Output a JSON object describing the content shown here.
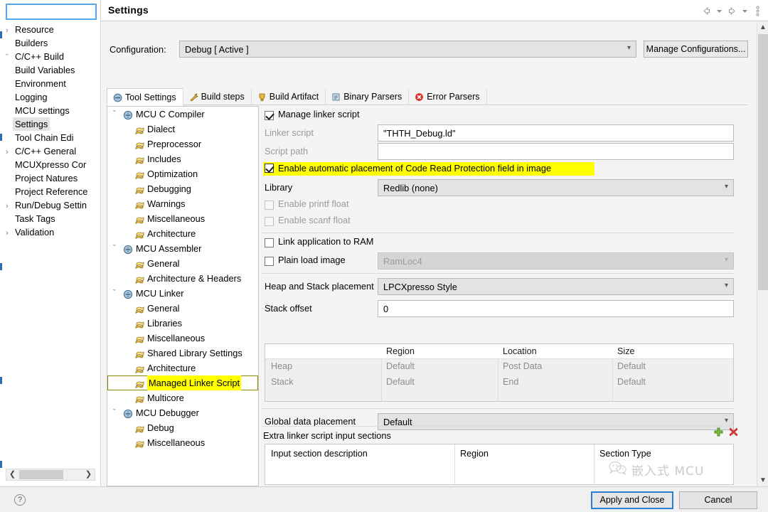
{
  "window": {
    "title": "Settings",
    "toolbar_icons": [
      "back-arrow-icon",
      "back-dropdown-icon",
      "forward-arrow-icon",
      "forward-dropdown-icon",
      "view-menu-icon"
    ]
  },
  "sidebar": {
    "filter_value": "",
    "filter_placeholder": "",
    "items": [
      {
        "label": "Resource",
        "arrow": "›",
        "indent": 0,
        "selected": false
      },
      {
        "label": "Builders",
        "arrow": "",
        "indent": 1,
        "selected": false
      },
      {
        "label": "C/C++ Build",
        "arrow": "⌄",
        "indent": 0,
        "selected": false
      },
      {
        "label": "Build Variables",
        "arrow": "",
        "indent": 1,
        "selected": false
      },
      {
        "label": "Environment",
        "arrow": "",
        "indent": 1,
        "selected": false
      },
      {
        "label": "Logging",
        "arrow": "",
        "indent": 1,
        "selected": false
      },
      {
        "label": "MCU settings",
        "arrow": "",
        "indent": 1,
        "selected": false
      },
      {
        "label": "Settings",
        "arrow": "",
        "indent": 1,
        "selected": true
      },
      {
        "label": "Tool Chain Edi",
        "arrow": "",
        "indent": 1,
        "selected": false
      },
      {
        "label": "C/C++ General",
        "arrow": "›",
        "indent": 0,
        "selected": false
      },
      {
        "label": "MCUXpresso Cor",
        "arrow": "",
        "indent": 1,
        "selected": false
      },
      {
        "label": "Project Natures",
        "arrow": "",
        "indent": 1,
        "selected": false
      },
      {
        "label": "Project Reference",
        "arrow": "",
        "indent": 1,
        "selected": false
      },
      {
        "label": "Run/Debug Settin",
        "arrow": "›",
        "indent": 0,
        "selected": false
      },
      {
        "label": "Task Tags",
        "arrow": "",
        "indent": 1,
        "selected": false
      },
      {
        "label": "Validation",
        "arrow": "›",
        "indent": 0,
        "selected": false
      }
    ],
    "hscroll": {
      "left_icon": "chevron-left-icon",
      "right_icon": "chevron-right-icon"
    }
  },
  "config": {
    "label": "Configuration:",
    "value": "Debug  [ Active ]",
    "manage_label": "Manage Configurations..."
  },
  "tabs": [
    {
      "label": "Tool Settings",
      "icon": "tool-settings-icon",
      "active": true
    },
    {
      "label": "Build steps",
      "icon": "wrench-icon",
      "active": false
    },
    {
      "label": "Build Artifact",
      "icon": "artifact-icon",
      "active": false
    },
    {
      "label": "Binary Parsers",
      "icon": "binary-parsers-icon",
      "active": false
    },
    {
      "label": "Error Parsers",
      "icon": "error-parsers-icon",
      "active": false
    }
  ],
  "tool_tree": [
    {
      "label": "MCU C Compiler",
      "level": 0,
      "arrow": "⌄",
      "icon": "tool-icon",
      "highlighted": false
    },
    {
      "label": "Dialect",
      "level": 1,
      "arrow": "",
      "icon": "page-icon",
      "highlighted": false
    },
    {
      "label": "Preprocessor",
      "level": 1,
      "arrow": "",
      "icon": "page-icon",
      "highlighted": false
    },
    {
      "label": "Includes",
      "level": 1,
      "arrow": "",
      "icon": "page-icon",
      "highlighted": false
    },
    {
      "label": "Optimization",
      "level": 1,
      "arrow": "",
      "icon": "page-icon",
      "highlighted": false
    },
    {
      "label": "Debugging",
      "level": 1,
      "arrow": "",
      "icon": "page-icon",
      "highlighted": false
    },
    {
      "label": "Warnings",
      "level": 1,
      "arrow": "",
      "icon": "page-icon",
      "highlighted": false
    },
    {
      "label": "Miscellaneous",
      "level": 1,
      "arrow": "",
      "icon": "page-icon",
      "highlighted": false
    },
    {
      "label": "Architecture",
      "level": 1,
      "arrow": "",
      "icon": "page-icon",
      "highlighted": false
    },
    {
      "label": "MCU Assembler",
      "level": 0,
      "arrow": "⌄",
      "icon": "tool-icon",
      "highlighted": false
    },
    {
      "label": "General",
      "level": 1,
      "arrow": "",
      "icon": "page-icon",
      "highlighted": false
    },
    {
      "label": "Architecture & Headers",
      "level": 1,
      "arrow": "",
      "icon": "page-icon",
      "highlighted": false
    },
    {
      "label": "MCU Linker",
      "level": 0,
      "arrow": "⌄",
      "icon": "tool-icon",
      "highlighted": false
    },
    {
      "label": "General",
      "level": 1,
      "arrow": "",
      "icon": "page-icon",
      "highlighted": false
    },
    {
      "label": "Libraries",
      "level": 1,
      "arrow": "",
      "icon": "page-icon",
      "highlighted": false
    },
    {
      "label": "Miscellaneous",
      "level": 1,
      "arrow": "",
      "icon": "page-icon",
      "highlighted": false
    },
    {
      "label": "Shared Library Settings",
      "level": 1,
      "arrow": "",
      "icon": "page-icon",
      "highlighted": false
    },
    {
      "label": "Architecture",
      "level": 1,
      "arrow": "",
      "icon": "page-icon",
      "highlighted": false
    },
    {
      "label": "Managed Linker Script",
      "level": 1,
      "arrow": "",
      "icon": "page-icon",
      "highlighted": true
    },
    {
      "label": "Multicore",
      "level": 1,
      "arrow": "",
      "icon": "page-icon",
      "highlighted": false
    },
    {
      "label": "MCU Debugger",
      "level": 0,
      "arrow": "⌄",
      "icon": "tool-icon",
      "highlighted": false
    },
    {
      "label": "Debug",
      "level": 1,
      "arrow": "",
      "icon": "page-icon",
      "highlighted": false
    },
    {
      "label": "Miscellaneous",
      "level": 1,
      "arrow": "",
      "icon": "page-icon",
      "highlighted": false
    }
  ],
  "settings": {
    "manage_linker_script": {
      "label": "Manage linker script",
      "checked": true
    },
    "linker_script": {
      "label": "Linker script",
      "value": "\"THTH_Debug.ld\""
    },
    "script_path": {
      "label": "Script path",
      "value": ""
    },
    "crp_field": {
      "label": "Enable automatic placement of Code Read Protection field in image",
      "checked": true,
      "highlight_color": "#ffff00"
    },
    "library": {
      "label": "Library",
      "value": "Redlib (none)"
    },
    "enable_printf_float": {
      "label": "Enable printf float",
      "checked": false
    },
    "enable_scanf_float": {
      "label": "Enable scanf float",
      "checked": false
    },
    "link_to_ram": {
      "label": "Link application to RAM",
      "checked": false
    },
    "plain_load_image": {
      "label": "Plain load image",
      "checked": false,
      "value": "RamLoc4"
    },
    "heap_stack_placement": {
      "label": "Heap and Stack placement",
      "value": "LPCXpresso Style"
    },
    "stack_offset": {
      "label": "Stack offset",
      "value": "0"
    },
    "heap_stack_table": {
      "columns": [
        "",
        "Region",
        "Location",
        "Size"
      ],
      "rows": [
        {
          "name": "Heap",
          "region": "Default",
          "location": "Post Data",
          "size": "Default"
        },
        {
          "name": "Stack",
          "region": "Default",
          "location": "End",
          "size": "Default"
        }
      ]
    },
    "global_data_placement": {
      "label": "Global data placement",
      "value": "Default"
    },
    "extra_sections": {
      "label": "Extra linker script input sections",
      "add_icon": "add-plus-icon",
      "remove_icon": "remove-x-icon",
      "columns": [
        "Input section description",
        "Region",
        "Section Type"
      ],
      "rows": []
    }
  },
  "scrollbar": {
    "up_icon": "chevron-up-icon",
    "down_icon": "chevron-down-icon"
  },
  "footer": {
    "help_icon": "help-question-icon",
    "apply_label": "Apply and Close",
    "cancel_label": "Cancel"
  },
  "watermark": {
    "text": "嵌入式 MCU",
    "icon": "wechat-icon"
  }
}
